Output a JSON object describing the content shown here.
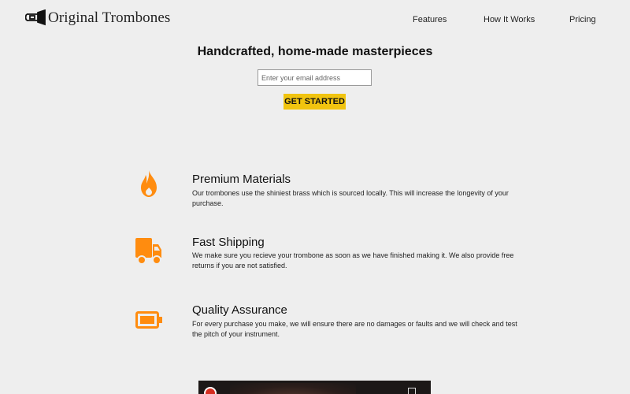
{
  "header": {
    "brand": "Original Trombones",
    "logo_icon": "trombone-icon",
    "nav": [
      "Features",
      "How It Works",
      "Pricing"
    ]
  },
  "hero": {
    "title": "Handcrafted, home-made masterpieces",
    "email_placeholder": "Enter your email address",
    "cta_label": "GET STARTED"
  },
  "features": [
    {
      "icon": "fire-icon",
      "title": "Premium Materials",
      "desc": "Our trombones use the shiniest brass which is sourced locally. This will increase the longevity of your purchase."
    },
    {
      "icon": "truck-icon",
      "title": "Fast Shipping",
      "desc": "We make sure you recieve your trombone as soon as we have finished making it. We also provide free returns if you are not satisfied."
    },
    {
      "icon": "battery-icon",
      "title": "Quality Assurance",
      "desc": "For every purchase you make, we will ensure there are no damages or faults and we will check and test the pitch of your instrument."
    }
  ],
  "colors": {
    "accent": "#f1c40f",
    "icon": "#ff8c0f",
    "background": "#eeeeee"
  }
}
